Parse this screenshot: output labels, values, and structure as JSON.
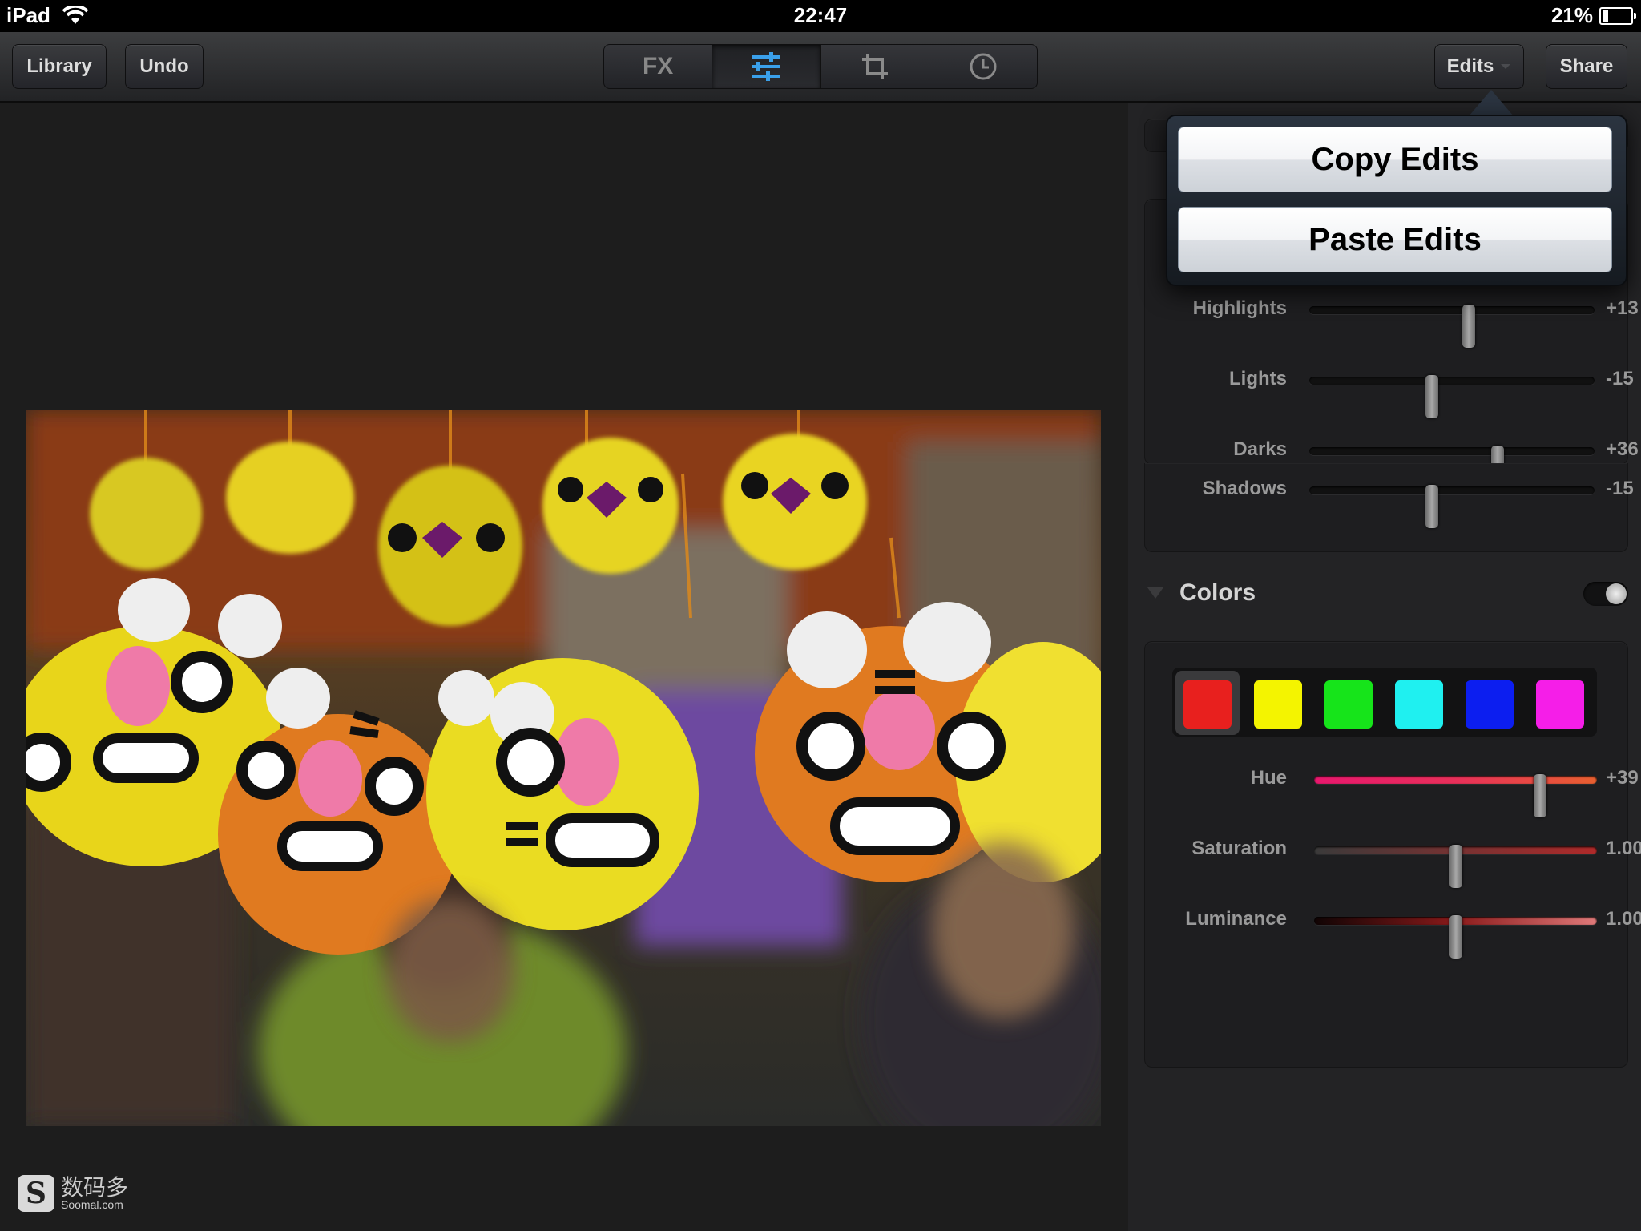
{
  "status": {
    "device": "iPad",
    "time": "22:47",
    "battery": "21%",
    "battery_level": 0.21
  },
  "toolbar": {
    "library": "Library",
    "undo": "Undo",
    "fx": "FX",
    "edits": "Edits",
    "share": "Share"
  },
  "tone_sliders": [
    {
      "label": "Highlights",
      "value": "+13",
      "position": 0.56
    },
    {
      "label": "Lights",
      "value": "-15",
      "position": 0.43
    },
    {
      "label": "Darks",
      "value": "+36",
      "position": 0.66
    },
    {
      "label": "Shadows",
      "value": "-15",
      "position": 0.43
    }
  ],
  "colors": {
    "title": "Colors",
    "enabled": true,
    "swatches": [
      "#e8201e",
      "#f4f400",
      "#16e41a",
      "#1ff0f0",
      "#0c1ef0",
      "#f51ee8"
    ],
    "selected_swatch": 0,
    "sliders": [
      {
        "label": "Hue",
        "value": "+39",
        "position": 0.8
      },
      {
        "label": "Saturation",
        "value": "1.00",
        "position": 0.5
      },
      {
        "label": "Luminance",
        "value": "1.00",
        "position": 0.5
      }
    ]
  },
  "popover": {
    "copy": "Copy Edits",
    "paste": "Paste Edits"
  },
  "watermark": {
    "cn": "数码多",
    "en": "Soomal.com"
  }
}
